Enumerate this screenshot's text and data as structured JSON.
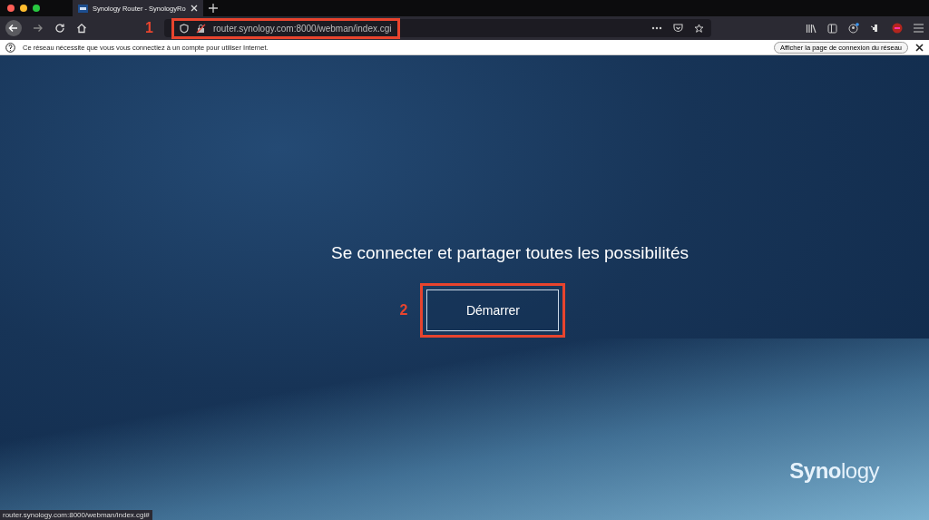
{
  "browser": {
    "tab": {
      "title": "Synology Router - SynologyRo",
      "selected": true
    },
    "address_bar": {
      "annotation": "1",
      "url": "router.synology.com:8000/webman/index.cgi"
    },
    "notification": {
      "message": "Ce réseau nécessite que vous vous connectiez à un compte pour utiliser Internet.",
      "button": "Afficher la page de connexion du réseau"
    },
    "status_url": "router.synology.com:8000/webman/index.cgi#"
  },
  "page": {
    "headline": "Se connecter et partager toutes les possibilités",
    "button_annotation": "2",
    "button": "Démarrer",
    "logo": "**Syno**logy"
  }
}
